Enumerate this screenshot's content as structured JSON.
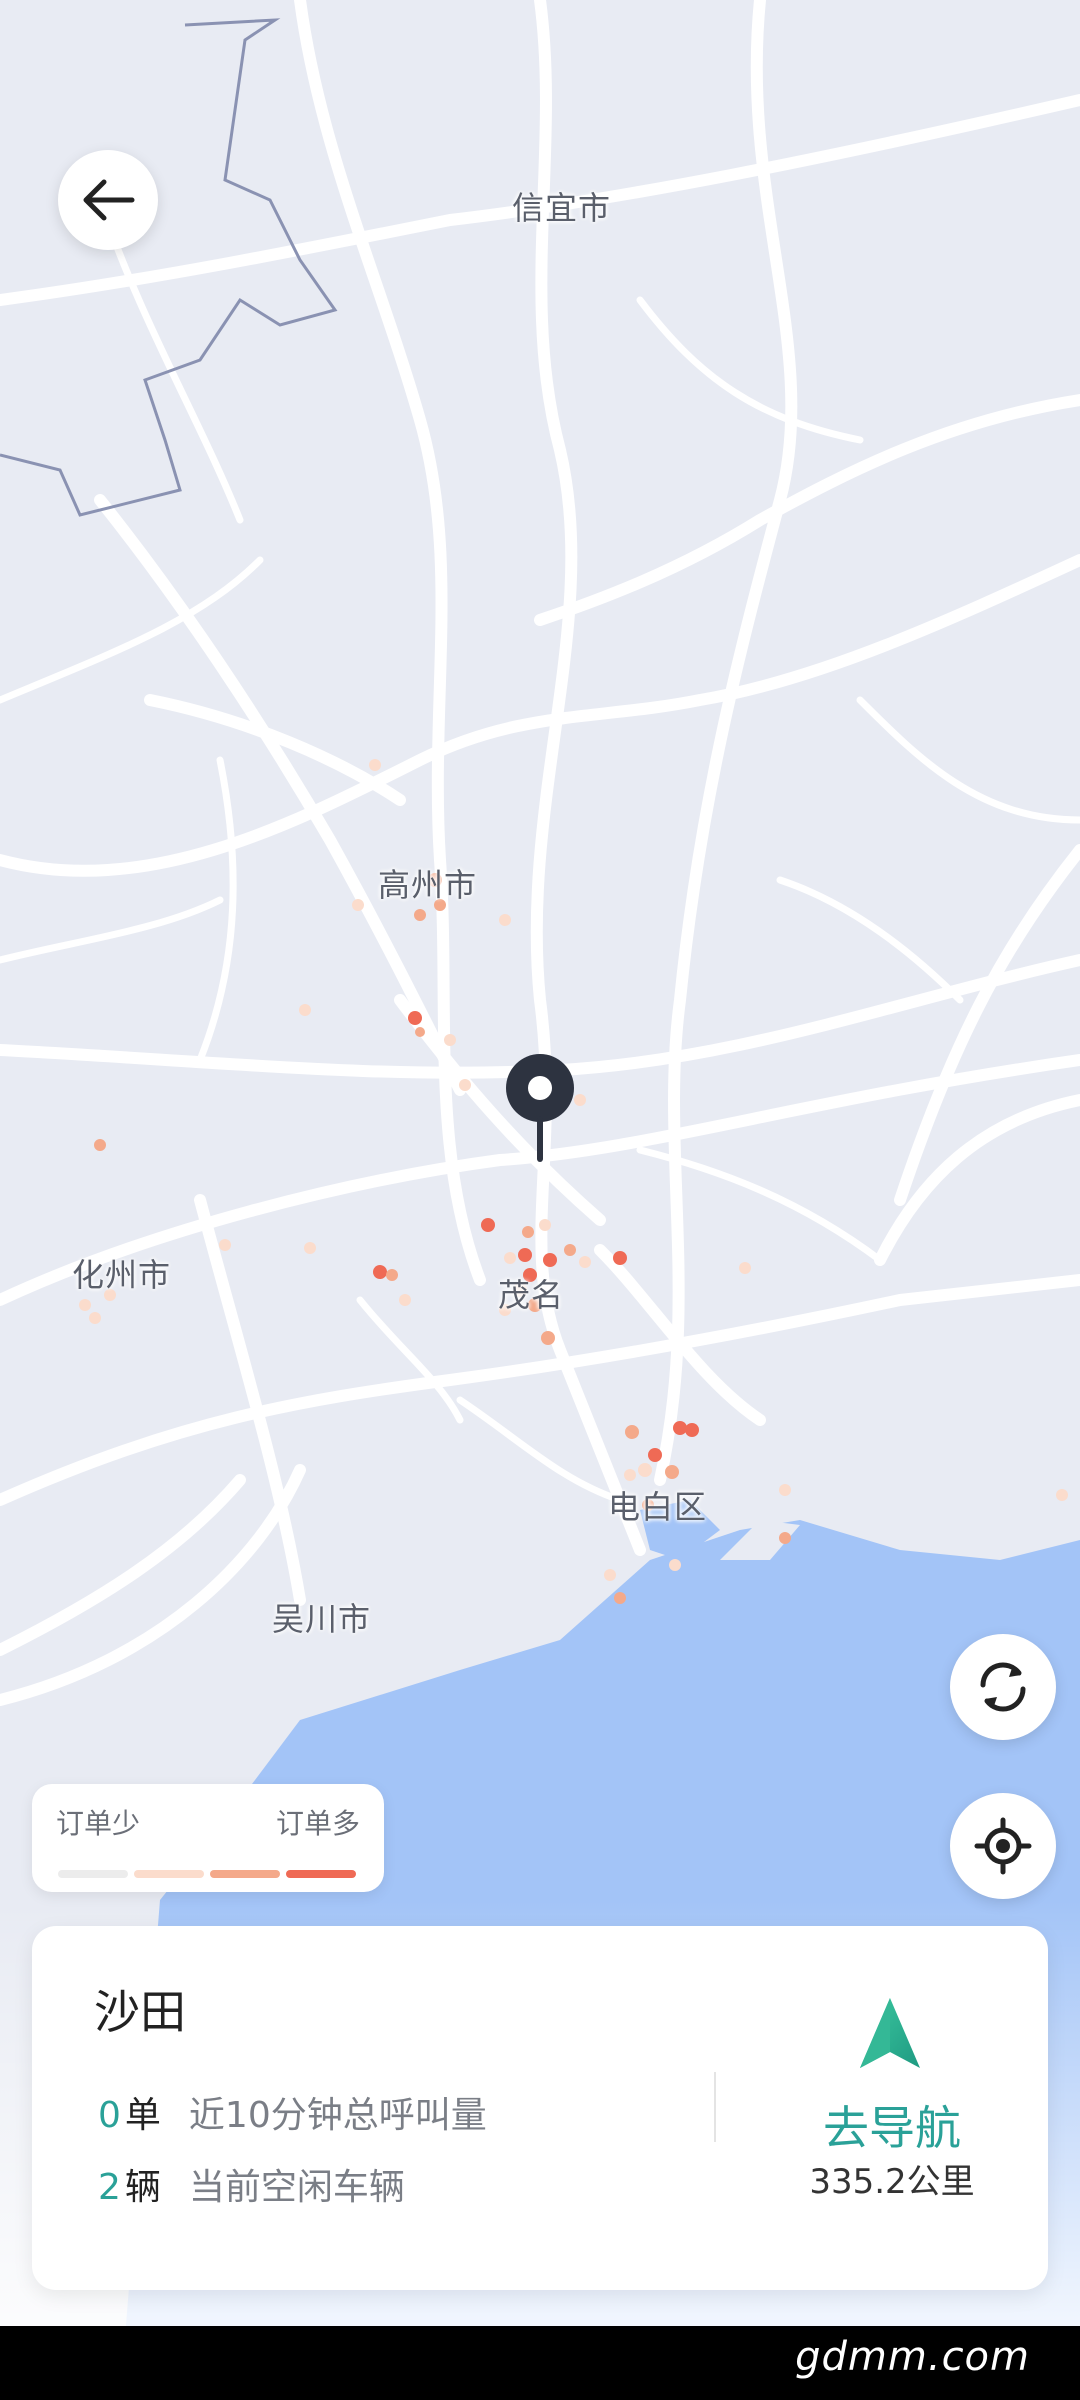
{
  "map": {
    "cities": {
      "xinyi": "信宜市",
      "gaozhou": "高州市",
      "huazhou": "化州市",
      "maoming": "茂名",
      "dianbai": "电白区",
      "wuchuan": "吴川市"
    }
  },
  "legend": {
    "low_label": "订单少",
    "high_label": "订单多",
    "colors": [
      "#ececec",
      "#fbdccc",
      "#f4a98a",
      "#ef6a55"
    ]
  },
  "card": {
    "area_name": "沙田",
    "orders": {
      "value": "0",
      "unit": "单",
      "desc": "近10分钟总呼叫量"
    },
    "vehicles": {
      "value": "2",
      "unit": "辆",
      "desc": "当前空闲车辆"
    },
    "navigate": {
      "label": "去导航",
      "distance": "335.2公里"
    }
  },
  "watermark": "gdmm.com",
  "colors": {
    "accent": "#2aa198",
    "sea": "#a3c4f7",
    "land": "#e8ebf3",
    "road": "#ffffff"
  }
}
